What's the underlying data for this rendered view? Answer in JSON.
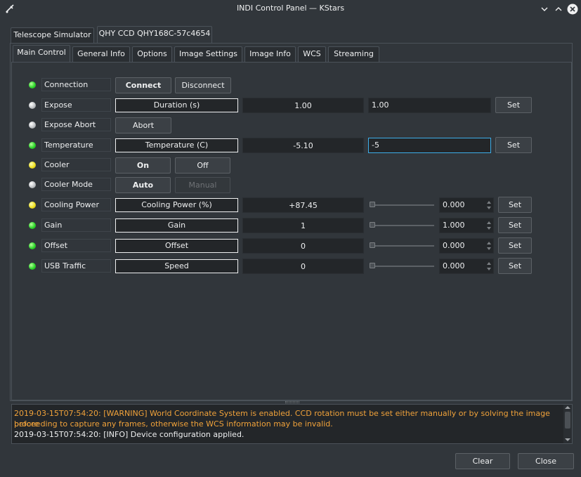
{
  "window": {
    "title": "INDI Control Panel — KStars"
  },
  "device_tabs": [
    "Telescope Simulator",
    "QHY CCD QHY168C-57c4654"
  ],
  "group_tabs": [
    "Main Control",
    "General Info",
    "Options",
    "Image Settings",
    "Image Info",
    "WCS",
    "Streaming"
  ],
  "properties": {
    "connection": {
      "label": "Connection",
      "state": "green",
      "buttons": [
        "Connect",
        "Disconnect"
      ]
    },
    "expose": {
      "label": "Expose",
      "state": "grey",
      "element": "Duration (s)",
      "value": "1.00",
      "input": "1.00",
      "set": "Set"
    },
    "expose_abort": {
      "label": "Expose Abort",
      "state": "grey",
      "buttons": [
        "Abort"
      ]
    },
    "temperature": {
      "label": "Temperature",
      "state": "green",
      "element": "Temperature (C)",
      "value": "-5.10",
      "input": "-5",
      "set": "Set"
    },
    "cooler": {
      "label": "Cooler",
      "state": "yellow",
      "buttons": [
        "On",
        "Off"
      ]
    },
    "cooler_mode": {
      "label": "Cooler Mode",
      "state": "grey",
      "buttons": [
        "Auto",
        "Manual"
      ]
    },
    "cooling_power": {
      "label": "Cooling Power",
      "state": "yellow",
      "element": "Cooling Power (%)",
      "value": "+87.45",
      "spin": "0.000",
      "set": "Set"
    },
    "gain": {
      "label": "Gain",
      "state": "green",
      "element": "Gain",
      "value": "1",
      "spin": "1.000",
      "set": "Set"
    },
    "offset": {
      "label": "Offset",
      "state": "green",
      "element": "Offset",
      "value": "0",
      "spin": "0.000",
      "set": "Set"
    },
    "usb_traffic": {
      "label": "USB Traffic",
      "state": "green",
      "element": "Speed",
      "value": "0",
      "spin": "0.000",
      "set": "Set"
    }
  },
  "log": {
    "warn_line1": "2019-03-15T07:54:20: [WARNING] World Coordinate System is enabled. CCD rotation must be set either manually or by solving the image before",
    "warn_line2": "proceeding to capture any frames, otherwise the WCS information may be invalid.",
    "info_line": "2019-03-15T07:54:20: [INFO] Device configuration applied."
  },
  "dialog_buttons": {
    "clear": "Clear",
    "close": "Close"
  },
  "colors": {
    "accent": "#3daee9",
    "warning": "#f0a23a",
    "background": "#31363b"
  }
}
